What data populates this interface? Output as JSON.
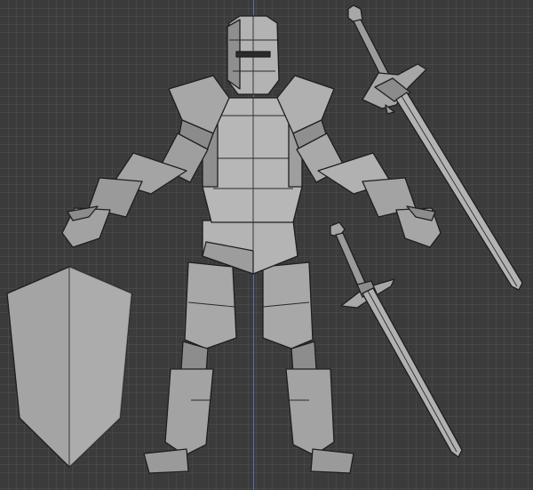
{
  "viewport": {
    "grid": true,
    "background_color": "#3b3b3b",
    "axis_z_color": "#5a7bd6"
  },
  "scene": {
    "objects": [
      "knight-armor",
      "greatsword",
      "longsword",
      "kite-shield"
    ],
    "mesh_fill": "#a9a9a9",
    "mesh_shadow": "#7b7b7b",
    "mesh_light": "#c3c3c3"
  }
}
